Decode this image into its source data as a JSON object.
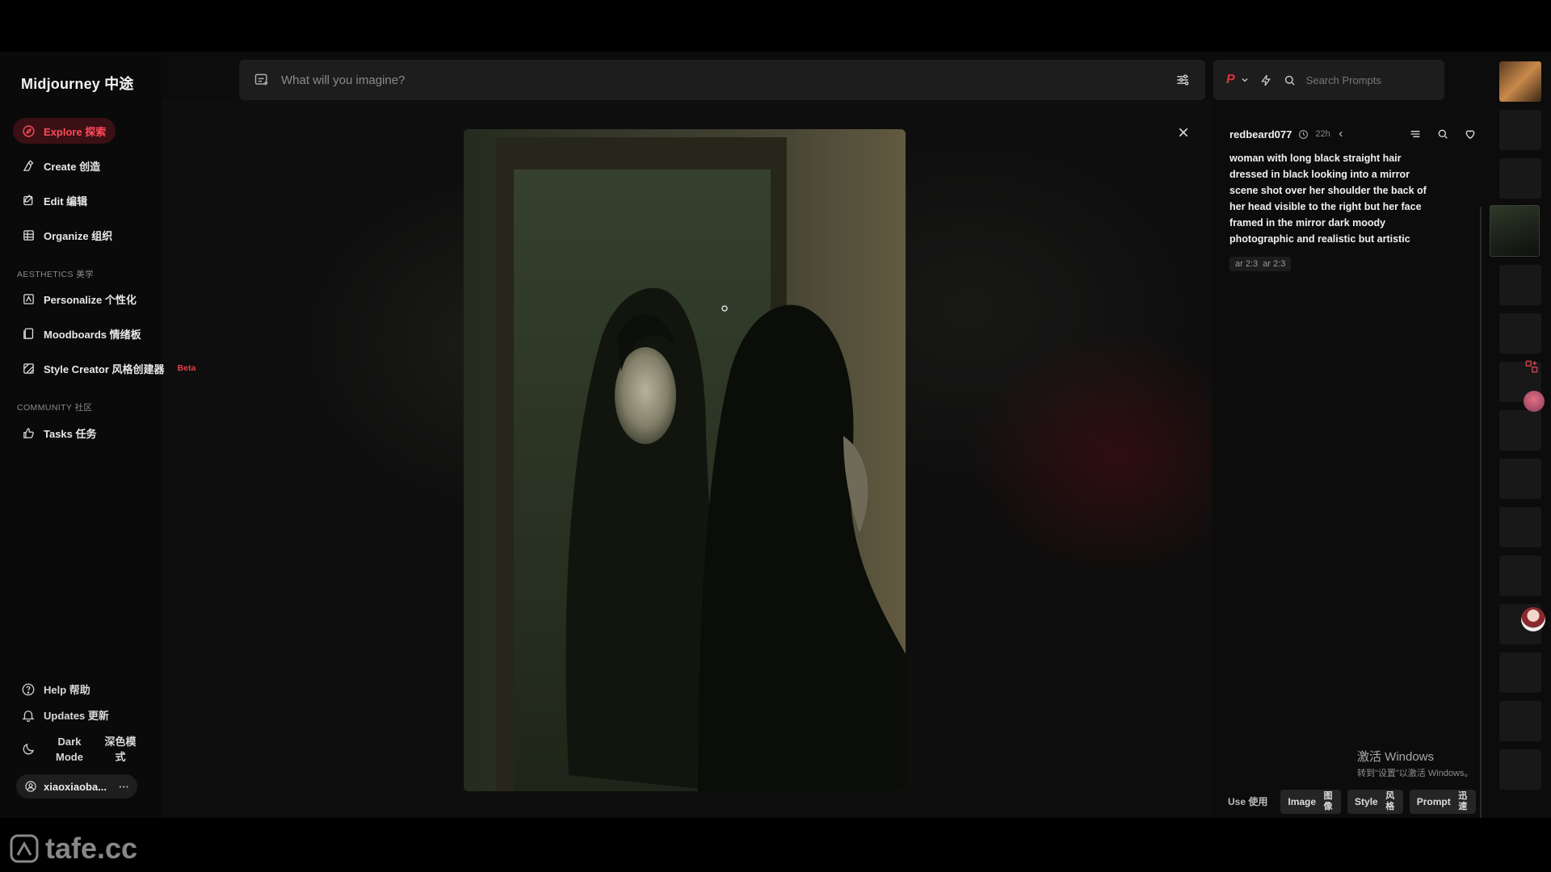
{
  "app": {
    "brand": "Midjourney 中途"
  },
  "sidebar": {
    "items": [
      {
        "label": "Explore 探索",
        "icon": "explore-icon",
        "active": true
      },
      {
        "label": "Create 创造",
        "icon": "create-icon"
      },
      {
        "label": "Edit 编辑",
        "icon": "edit-icon"
      },
      {
        "label": "Organize 组织",
        "icon": "organize-icon"
      }
    ],
    "aesthetics_label": "AESTHETICS 美学",
    "aesthetics_items": [
      {
        "label": "Personalize 个性化",
        "icon": "personalize-icon"
      },
      {
        "label": "Moodboards 情绪板",
        "icon": "moodboards-icon"
      },
      {
        "label": "Style Creator 风格创建器",
        "icon": "style-creator-icon",
        "badge": "Beta"
      }
    ],
    "community_label": "COMMUNITY 社区",
    "community_items": [
      {
        "label": "Tasks 任务",
        "icon": "thumbs-up-icon"
      }
    ],
    "bottom": {
      "help": "Help 帮助",
      "updates": "Updates 更新",
      "dark_mode_en": "Dark Mode",
      "dark_mode_cn": "深色模式",
      "user": "xiaoxiaoba...",
      "more": "···"
    }
  },
  "imagine": {
    "placeholder": "What will you imagine?"
  },
  "search": {
    "logo": "P",
    "placeholder": "Search Prompts"
  },
  "detail": {
    "author": "redbeard077",
    "time": "22h",
    "prompt": "woman with long black straight hair dressed in black looking into a mirror scene shot over her shoulder the back of her head visible to the right but her face framed in the mirror dark moody photographic and realistic but artistic",
    "tags": [
      "ar 2:3",
      "ar 2:3"
    ],
    "use_label": "Use 使用",
    "use_buttons": [
      {
        "en": "Image",
        "cn": "图像"
      },
      {
        "en": "Style",
        "cn": "风格"
      },
      {
        "en": "Prompt",
        "cn": "迅速"
      }
    ]
  },
  "overlay": {
    "windows_line1": "激活 Windows",
    "windows_line2": "转到\"设置\"以激活 Windows。",
    "site_watermark": "tafe.cc"
  },
  "colors": {
    "accent": "#ff4a5a",
    "active_bg": "#3a1014",
    "panel": "#1d1d1d",
    "background": "#0c0c0c"
  }
}
